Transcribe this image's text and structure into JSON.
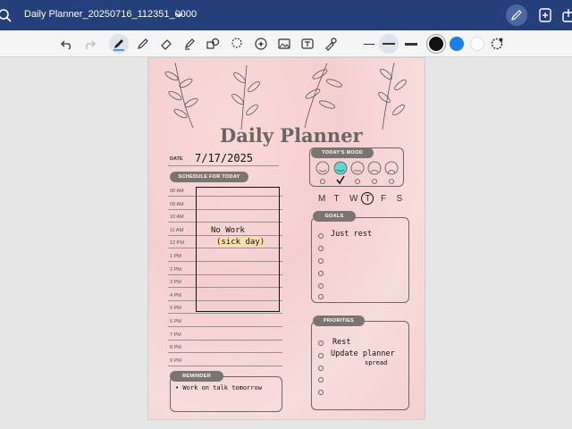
{
  "titlebar": {
    "doc_title": "Daily Planner_20250716_112351_0000",
    "colors": {
      "bar": "#243f7a"
    }
  },
  "toolbar": {
    "tools": [
      "undo-icon",
      "redo-icon",
      "pen-icon",
      "pencil-icon",
      "eraser-icon",
      "highlighter-icon",
      "shapes-icon",
      "lasso-icon",
      "sticker-icon",
      "image-icon",
      "text-icon",
      "eyedropper-icon"
    ],
    "colors": [
      "#111111",
      "#1a7fe8",
      "#ffffff"
    ]
  },
  "planner": {
    "title": "Daily Planner",
    "date_label": "DATE",
    "date_value": "7/17/2025",
    "schedule_label": "SCHEDULE FOR TODAY",
    "times": [
      "08 AM",
      "09 AM",
      "10 AM",
      "11 AM",
      "12 PM",
      "1 PM",
      "2 PM",
      "3 PM",
      "4 PM",
      "5 PM",
      "6 PM",
      "7 PM",
      "8 PM",
      "9 PM"
    ],
    "schedule_note_1": "No Work",
    "schedule_note_2": "(sick day)",
    "reminder_label": "REMINDER",
    "reminder_text": "• Work on talk tomorrow",
    "mood_label": "TODAY'S MOOD",
    "days": [
      "M",
      "T",
      "W",
      "T",
      "F",
      "S"
    ],
    "goals_label": "GOALS",
    "goals": [
      "Just rest"
    ],
    "priorities_label": "PRIORITIES",
    "priorities": [
      "Rest",
      "Update planner",
      "spread"
    ]
  }
}
